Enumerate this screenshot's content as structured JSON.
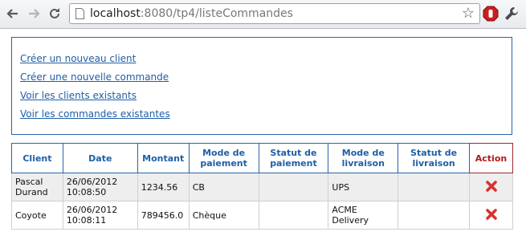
{
  "browser": {
    "url_host": "localhost",
    "url_rest": ":8080/tp4/listeCommandes"
  },
  "menu": {
    "links": [
      "Créer un nouveau client",
      "Créer une nouvelle commande",
      "Voir les clients existants",
      "Voir les commandes existantes"
    ]
  },
  "table": {
    "headers": {
      "client": "Client",
      "date": "Date",
      "montant": "Montant",
      "mode_paiement": "Mode de paiement",
      "statut_paiement": "Statut de paiement",
      "mode_livraison": "Mode de livraison",
      "statut_livraison": "Statut de livraison",
      "action": "Action"
    },
    "rows": [
      {
        "client": "Pascal Durand",
        "date": "26/06/2012 10:08:50",
        "montant": "1234.56",
        "mode_paiement": "CB",
        "statut_paiement": "",
        "mode_livraison": "UPS",
        "statut_livraison": ""
      },
      {
        "client": "Coyote",
        "date": "26/06/2012 10:08:11",
        "montant": "789456.0",
        "mode_paiement": "Chèque",
        "statut_paiement": "",
        "mode_livraison": "ACME Delivery",
        "statut_livraison": ""
      }
    ]
  },
  "colors": {
    "link": "#1f5fa6",
    "header_border": "#2a64a8",
    "action_header": "#b01b1b",
    "delete_icon": "#d9322b"
  },
  "icons": [
    "back-arrow-icon",
    "forward-arrow-icon",
    "reload-icon",
    "page-icon",
    "bookmark-star-icon",
    "stop-extension-icon",
    "wrench-icon",
    "delete-icon"
  ]
}
